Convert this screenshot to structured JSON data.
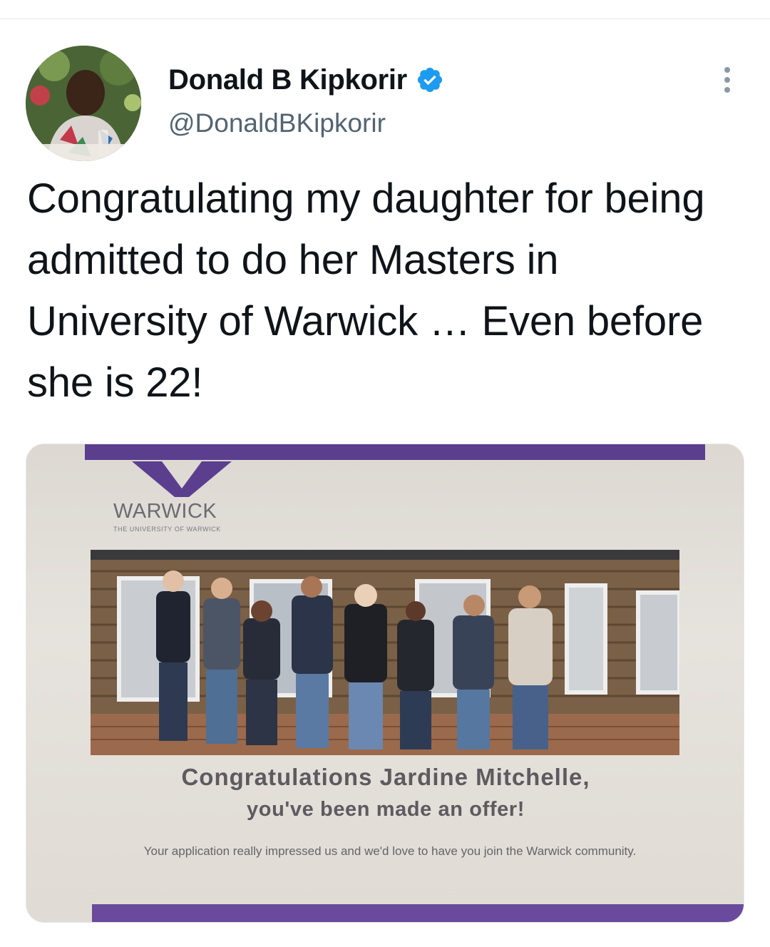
{
  "author": {
    "display_name": "Donald B Kipkorir",
    "handle": "@DonaldBKipkorir",
    "avatar_icon": "profile-photo",
    "verified_icon": "verified-badge-icon",
    "verified_color": "#1d9bf0"
  },
  "more_icon": "more-options-icon",
  "tweet": {
    "text": "Congratulating my daughter for being admitted to do her Masters in University of Warwick … Even before she is 22!"
  },
  "media": {
    "logo_word": "WARWICK",
    "logo_sub": "THE UNIVERSITY OF WARWICK",
    "headline": "Congratulations Jardine Mitchelle,",
    "subheadline": "you've been made an offer!",
    "body": "Your application really impressed us and we'd love to have you join the Warwick community.",
    "brand_color": "#5b3f8e"
  }
}
